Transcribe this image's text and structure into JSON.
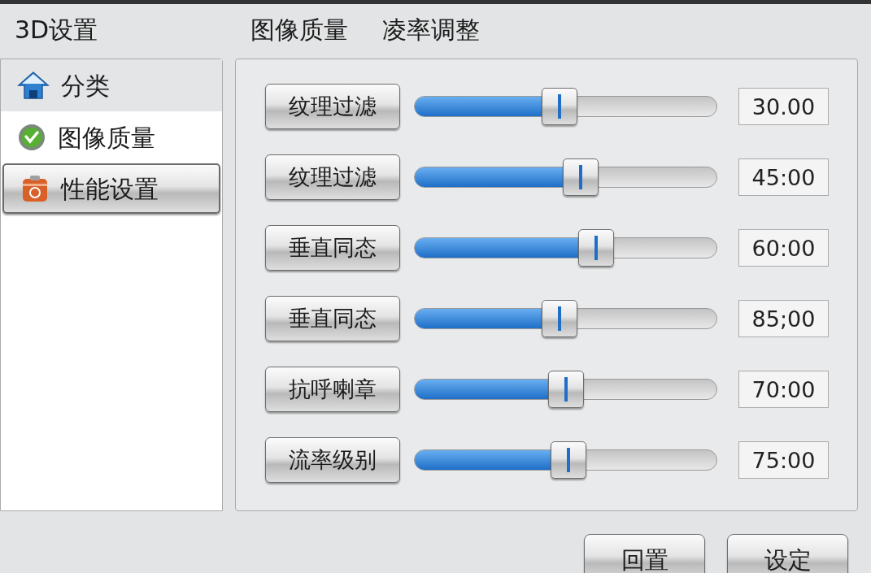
{
  "window": {
    "title": "3D设置"
  },
  "header_tabs": [
    "图像质量",
    "凌率调整"
  ],
  "sidebar": {
    "items": [
      {
        "label": "分类",
        "kind": "category",
        "selected": false
      },
      {
        "label": "图像质量",
        "kind": "check",
        "selected": false
      },
      {
        "label": "性能设置",
        "kind": "toolbox",
        "selected": true
      }
    ]
  },
  "settings": [
    {
      "label": "纹理过滤",
      "level": 0.48,
      "value": "30.00"
    },
    {
      "label": "纹理过滤",
      "level": 0.55,
      "value": "45:00"
    },
    {
      "label": "垂直同态",
      "level": 0.6,
      "value": "60:00"
    },
    {
      "label": "垂直同态",
      "level": 0.48,
      "value": "85;00"
    },
    {
      "label": "抗呼喇章",
      "level": 0.5,
      "value": "70:00"
    },
    {
      "label": "流率级别",
      "level": 0.51,
      "value": "75:00"
    }
  ],
  "buttons": [
    "回置",
    "设定"
  ]
}
